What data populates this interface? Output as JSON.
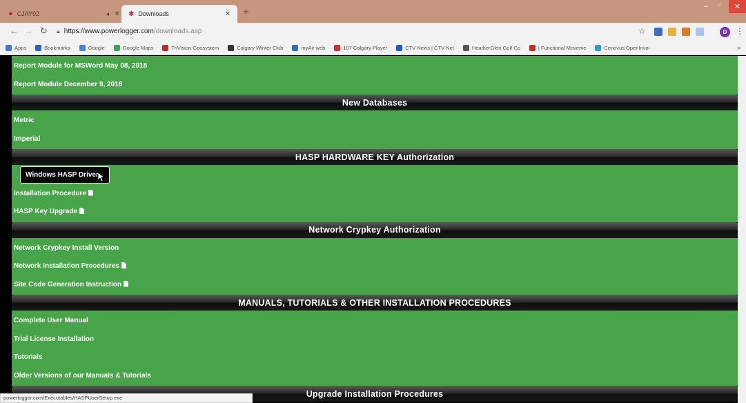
{
  "tabs": [
    {
      "title": "CJAY92",
      "active": false
    },
    {
      "title": "Downloads",
      "active": true
    }
  ],
  "address": {
    "host": "https://www.powerlogger.com",
    "path": "/downloads.asp"
  },
  "profile_initial": "D",
  "bookmarks": [
    {
      "label": "Apps",
      "icon": "apps-grid-icon",
      "color": "#4a78c2"
    },
    {
      "label": "Bookmarks",
      "icon": "star-icon",
      "color": "#2b63c6"
    },
    {
      "label": "Google",
      "icon": "google-icon",
      "color": "#4285f4"
    },
    {
      "label": "Google Maps",
      "icon": "maps-icon",
      "color": "#34a853"
    },
    {
      "label": "TriVision Geosystem",
      "icon": "trivision-icon",
      "color": "#c0292a"
    },
    {
      "label": "Calgary Winter Club",
      "icon": "calgary-club-icon",
      "color": "#333333"
    },
    {
      "label": "myAir web",
      "icon": "myair-icon",
      "color": "#2d6cdf"
    },
    {
      "label": "107 Calgary Player",
      "icon": "radio-icon",
      "color": "#d13030"
    },
    {
      "label": "CTV News | CTV Net",
      "icon": "ctv-icon",
      "color": "#1a5fc8"
    },
    {
      "label": "HeatherGlen Golf Co",
      "icon": "golf-icon",
      "color": "#555555"
    },
    {
      "label": "| Functional Moveme",
      "icon": "fms-icon",
      "color": "#d42828"
    },
    {
      "label": "Cenovus OpenInvoi",
      "icon": "cenovus-icon",
      "color": "#2aa0d8"
    }
  ],
  "sections": [
    {
      "type": "link",
      "label": "Report Module for MSWord May 08, 2018",
      "doc": false
    },
    {
      "type": "link",
      "label": "Report Module December 9, 2018",
      "doc": false
    },
    {
      "type": "header",
      "label": "New Databases"
    },
    {
      "type": "link",
      "label": "Metric",
      "doc": false
    },
    {
      "type": "link",
      "label": "Imperial",
      "doc": false
    },
    {
      "type": "header",
      "label": "HASP HARDWARE KEY Authorization"
    },
    {
      "type": "link",
      "label": "Windows HASP Driver",
      "doc": false,
      "hovered": true
    },
    {
      "type": "link",
      "label": "Installation Procedure",
      "doc": true
    },
    {
      "type": "link",
      "label": "HASP Key Upgrade",
      "doc": true
    },
    {
      "type": "header",
      "label": "Network Crypkey Authorization"
    },
    {
      "type": "link",
      "label": "Network Crypkey Install Version",
      "doc": false
    },
    {
      "type": "link",
      "label": "Network Installation Procedures",
      "doc": true
    },
    {
      "type": "link",
      "label": "Site Code Generation Instruction",
      "doc": true
    },
    {
      "type": "header",
      "label": "MANUALS, TUTORIALS & OTHER INSTALLATION PROCEDURES"
    },
    {
      "type": "link",
      "label": "Complete User Manual",
      "doc": false
    },
    {
      "type": "link",
      "label": "Trial License Installation",
      "doc": false
    },
    {
      "type": "link",
      "label": "Tutorials",
      "doc": false
    },
    {
      "type": "link",
      "label": "Older Versions of our Manuals & Tutorials",
      "doc": false
    },
    {
      "type": "header",
      "label": "Upgrade Installation Procedures"
    }
  ],
  "status_url": "powerlogger.com/Executables/HASPUserSetup.exe",
  "colors": {
    "link_background": "#47a448",
    "header_background": "#1a1a1a",
    "tabstrip": "#c7967e"
  }
}
